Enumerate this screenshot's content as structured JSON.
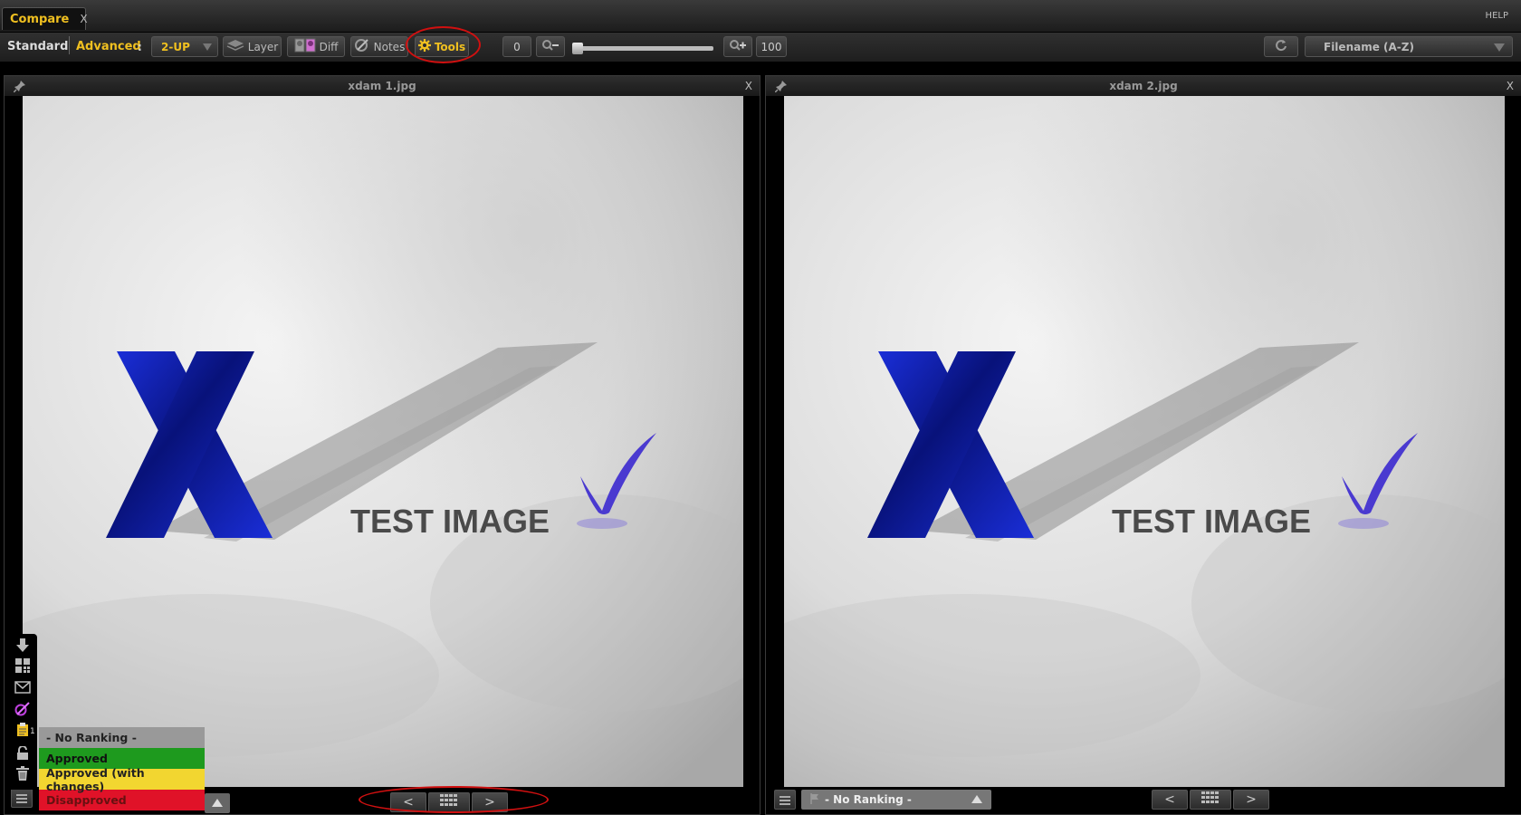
{
  "tab": {
    "label": "Compare",
    "close": "X"
  },
  "help": "HELP",
  "toolbar": {
    "standard": "Standard",
    "advanced": "Advanced",
    "colon": ":",
    "layout_value": "2-UP",
    "layer": "Layer",
    "diff": "Diff",
    "notes": "Notes",
    "tools": "Tools",
    "zoom_min": "0",
    "zoom_max": "100",
    "zoom_level": 0,
    "sort_value": "Filename (A-Z)"
  },
  "panes": [
    {
      "title": "xdam 1.jpg",
      "close": "X",
      "image": {
        "logo_letter": "X",
        "caption": "TEST IMAGE"
      },
      "nav": {
        "prev": "<",
        "next": ">"
      }
    },
    {
      "title": "xdam 2.jpg",
      "close": "X",
      "image": {
        "logo_letter": "X",
        "caption": "TEST IMAGE"
      },
      "nav": {
        "prev": "<",
        "next": ">"
      },
      "ranking": "- No Ranking -"
    }
  ],
  "ranking_options": [
    "- No Ranking -",
    "Approved",
    "Approved (with changes)",
    "Disapproved"
  ],
  "sidebar_badge": "1",
  "colors": {
    "accent": "#f0c020",
    "approved": "#1e9a1e",
    "approved_changes": "#f2d630",
    "disapproved": "#e01228",
    "annotation": "#d01010"
  }
}
